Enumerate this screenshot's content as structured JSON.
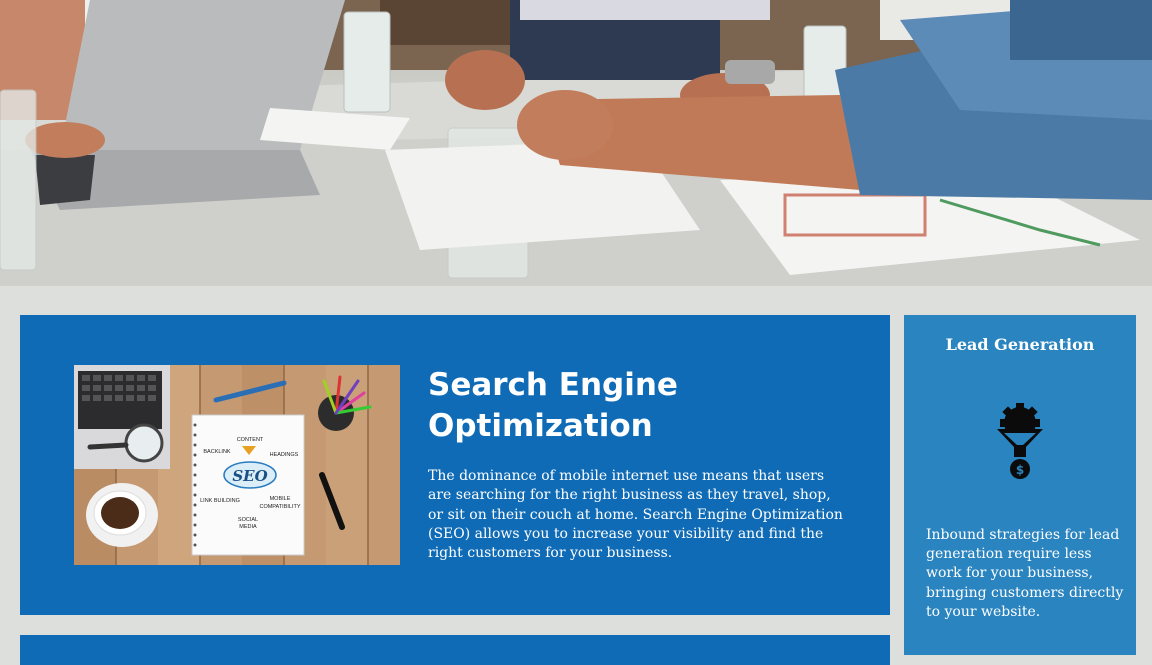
{
  "seo": {
    "title": "Search Engine Optimization",
    "body": "The dominance of mobile internet use means that users are searching for the right business as they travel, shop, or sit on their couch at home. Search Engine Optimization (SEO) allows you to increase your visibility and find the right customers for your business.",
    "image_words": {
      "seo": "SEO",
      "content": "CONTENT",
      "backlink": "BACKLINK",
      "headings": "HEADINGS",
      "link_building": "LINK BUILDING",
      "mobile": "MOBILE",
      "compatibility": "COMPATIBILITY",
      "social": "SOCIAL",
      "media": "MEDIA"
    }
  },
  "lead_generation": {
    "title": "Lead Generation",
    "icon": "funnel-gear-dollar-icon",
    "body": "Inbound strategies for lead generation require less work for your business, bringing customers directly to your website."
  },
  "colors": {
    "primary_card": "#0f6bb5",
    "side_card": "#2a84bf",
    "page_background": "#dcdfdc"
  }
}
